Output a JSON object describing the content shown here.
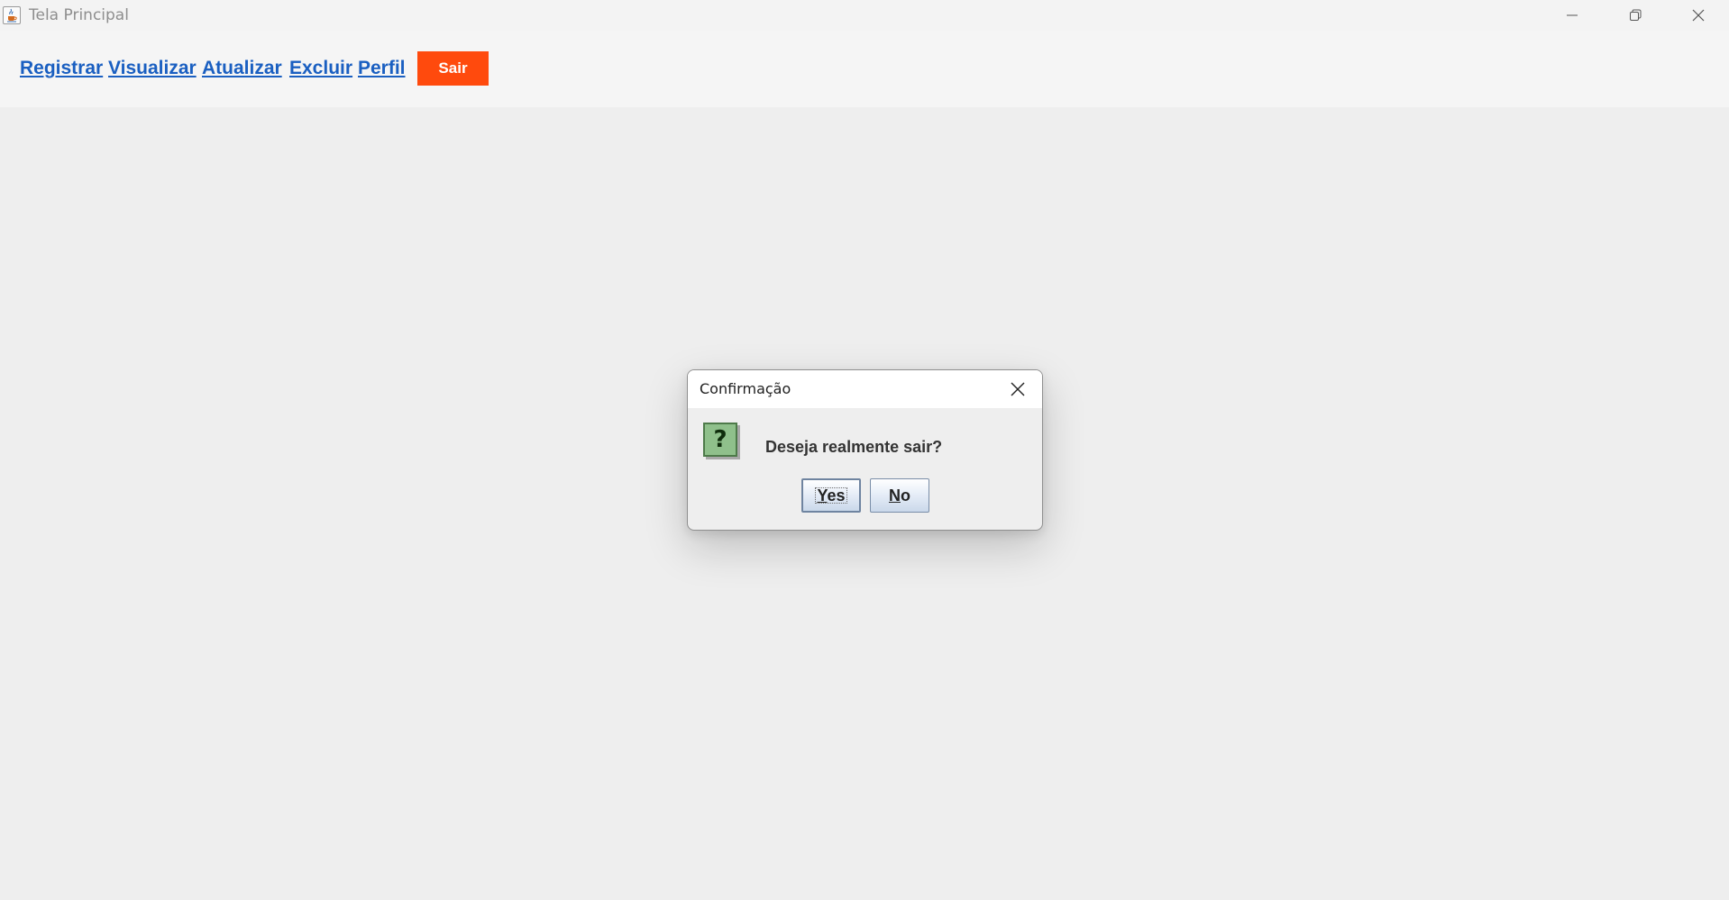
{
  "window": {
    "title": "Tela Principal",
    "icon": "java-cup-icon",
    "controls": [
      "minimize-icon",
      "restore-icon",
      "close-icon"
    ]
  },
  "menu": {
    "links": [
      {
        "label": "Registrar"
      },
      {
        "label": "Visualizar"
      },
      {
        "label": "Atualizar"
      },
      {
        "label": "Excluir"
      },
      {
        "label": "Perfil"
      }
    ],
    "exit_label": "Sair"
  },
  "dialog": {
    "title": "Confirmação",
    "icon": "question-icon",
    "icon_glyph": "?",
    "message": "Deseja realmente sair?",
    "yes": {
      "mnemonic": "Y",
      "rest": "es"
    },
    "no": {
      "mnemonic": "N",
      "rest": "o"
    }
  },
  "colors": {
    "link": "#1a5fc1",
    "exit_button": "#ff4a0d",
    "background": "#eeeeee",
    "question_icon": "#8fc08b"
  }
}
